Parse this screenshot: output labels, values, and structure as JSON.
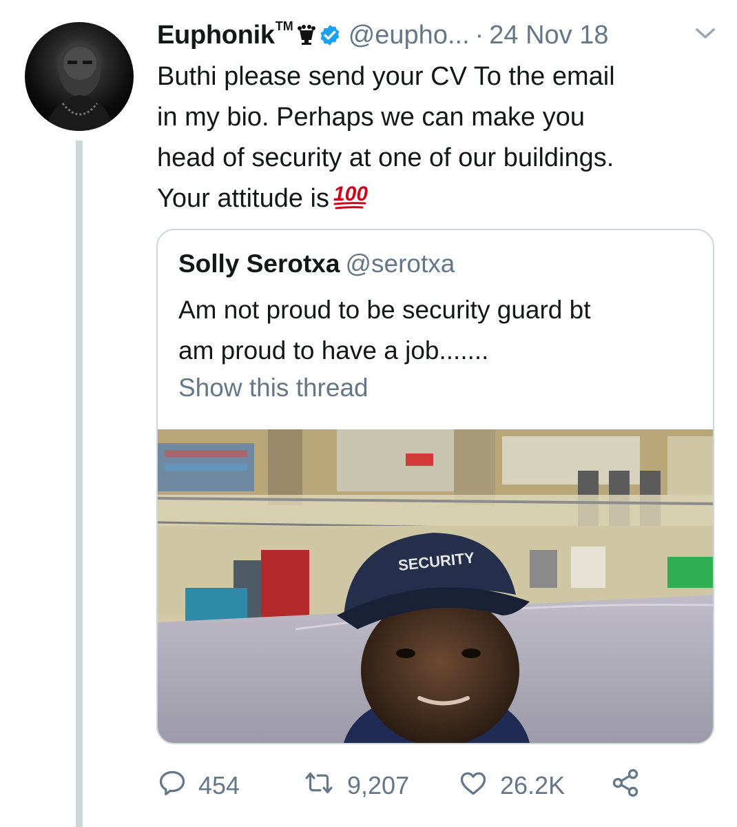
{
  "tweet": {
    "author": {
      "name": "Euphonik",
      "trademark": "TM",
      "handle": "@eupho...",
      "verified": true
    },
    "separator": "·",
    "date": "24 Nov 18",
    "text_lines": [
      "Buthi please send your CV To the email",
      "in my bio. Perhaps we can make you",
      "head of security at one of our buildings.",
      "Your attitude is"
    ],
    "emoji": "100"
  },
  "quoted_tweet": {
    "author_name": "Solly Serotxa",
    "handle": "@serotxa",
    "text_lines": [
      "Am not proud to be security guard  bt",
      "am proud to have a job......."
    ],
    "show_thread_label": "Show this thread",
    "photo_cap_text": "SECURITY"
  },
  "actions": {
    "replies": "454",
    "retweets": "9,207",
    "likes": "26.2K"
  },
  "icons": [
    "crown-icon",
    "verified-badge-icon",
    "chevron-down-icon",
    "reply-icon",
    "retweet-icon",
    "like-icon",
    "share-icon"
  ],
  "colors": {
    "text": "#14171a",
    "secondary": "#657786",
    "verified": "#1da1f2",
    "border": "#ccd6dd",
    "emoji_red": "#d0021b"
  }
}
